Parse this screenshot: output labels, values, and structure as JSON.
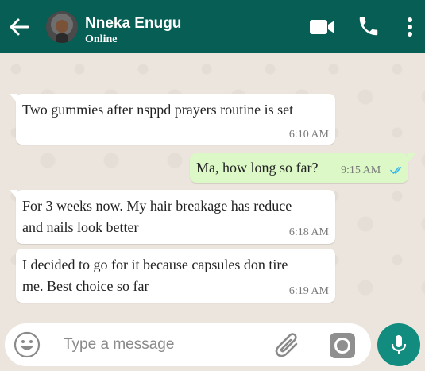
{
  "header": {
    "contact_name": "Nneka Enugu",
    "status": "Online",
    "background_color": "#075e54",
    "icons": [
      "back-arrow-icon",
      "video-call-icon",
      "phone-icon",
      "more-options-icon"
    ]
  },
  "messages": [
    {
      "direction": "incoming",
      "line1": "Two gummies after nsppd prayers routine is set",
      "line2": "",
      "time": "6:10 AM"
    },
    {
      "direction": "outgoing",
      "line1": "Ma, how long so far?",
      "line2": "",
      "time": "9:15 AM",
      "read_receipt": "double-check-icon"
    },
    {
      "direction": "incoming",
      "line1": "For 3 weeks now. My hair breakage has reduce",
      "line2": "and nails look better",
      "time": "6:18 AM"
    },
    {
      "direction": "incoming",
      "line1": "I decided to go for it because capsules don tire",
      "line2": "me. Best choice so far",
      "time": "6:19 AM"
    }
  ],
  "composer": {
    "placeholder": "Type a message",
    "value": "",
    "icons": [
      "emoji-icon",
      "paperclip-icon",
      "camera-icon",
      "microphone-icon"
    ],
    "send_button_color": "#128c7e"
  },
  "colors": {
    "incoming_bubble": "#ffffff",
    "outgoing_bubble": "#dcf8c6",
    "chat_background": "#ece5dd",
    "read_tick": "#34b7f1"
  }
}
